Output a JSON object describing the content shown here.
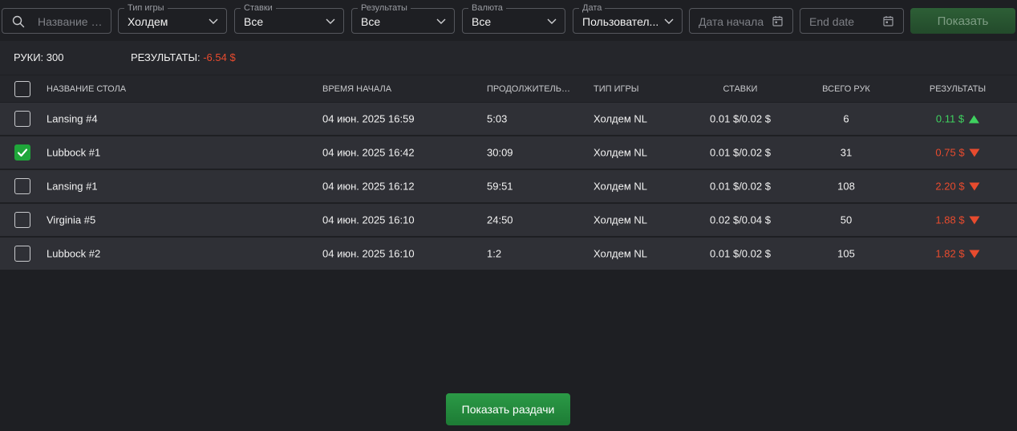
{
  "filters": {
    "search": {
      "placeholder": "Название ст..."
    },
    "game_type": {
      "label": "Тип игры",
      "value": "Холдем"
    },
    "stakes": {
      "label": "Ставки",
      "value": "Все"
    },
    "results": {
      "label": "Результаты",
      "value": "Все"
    },
    "currency": {
      "label": "Валюта",
      "value": "Все"
    },
    "date": {
      "label": "Дата",
      "value": "Пользовател..."
    },
    "start_date": {
      "placeholder": "Дата начала"
    },
    "end_date": {
      "placeholder": "End date"
    },
    "show_label": "Показать"
  },
  "summary": {
    "hands_text": "РУКИ: 300",
    "results_label": "РЕЗУЛЬТАТЫ:",
    "results_value": "-6.54 $"
  },
  "table": {
    "headers": {
      "name": "Название стола",
      "start_time": "Время начала",
      "duration": "Продолжительность",
      "game_type": "Тип игры",
      "stakes": "Ставки",
      "total_hands": "Всего рук",
      "results": "Результаты"
    },
    "rows": [
      {
        "checked": false,
        "name": "Lansing #4",
        "start_time": "04 июн. 2025 16:59",
        "duration": "5:03",
        "game_type": "Холдем NL",
        "stakes": "0.01 $/0.02 $",
        "hands": "6",
        "result": "0.11 $",
        "trend": "up"
      },
      {
        "checked": true,
        "name": "Lubbock #1",
        "start_time": "04 июн. 2025 16:42",
        "duration": "30:09",
        "game_type": "Холдем NL",
        "stakes": "0.01 $/0.02 $",
        "hands": "31",
        "result": "0.75 $",
        "trend": "down"
      },
      {
        "checked": false,
        "name": "Lansing #1",
        "start_time": "04 июн. 2025 16:12",
        "duration": "59:51",
        "game_type": "Холдем NL",
        "stakes": "0.01 $/0.02 $",
        "hands": "108",
        "result": "2.20 $",
        "trend": "down"
      },
      {
        "checked": false,
        "name": "Virginia #5",
        "start_time": "04 июн. 2025 16:10",
        "duration": "24:50",
        "game_type": "Холдем NL",
        "stakes": "0.02 $/0.04 $",
        "hands": "50",
        "result": "1.88 $",
        "trend": "down"
      },
      {
        "checked": false,
        "name": "Lubbock #2",
        "start_time": "04 июн. 2025 16:10",
        "duration": "1:2",
        "game_type": "Холдем NL",
        "stakes": "0.01 $/0.02 $",
        "hands": "105",
        "result": "1.82 $",
        "trend": "down"
      }
    ]
  },
  "bottom_button_label": "Показать раздачи",
  "colors": {
    "positive": "#3fd15f",
    "negative": "#e84b2e",
    "accent": "#1fa63a"
  }
}
